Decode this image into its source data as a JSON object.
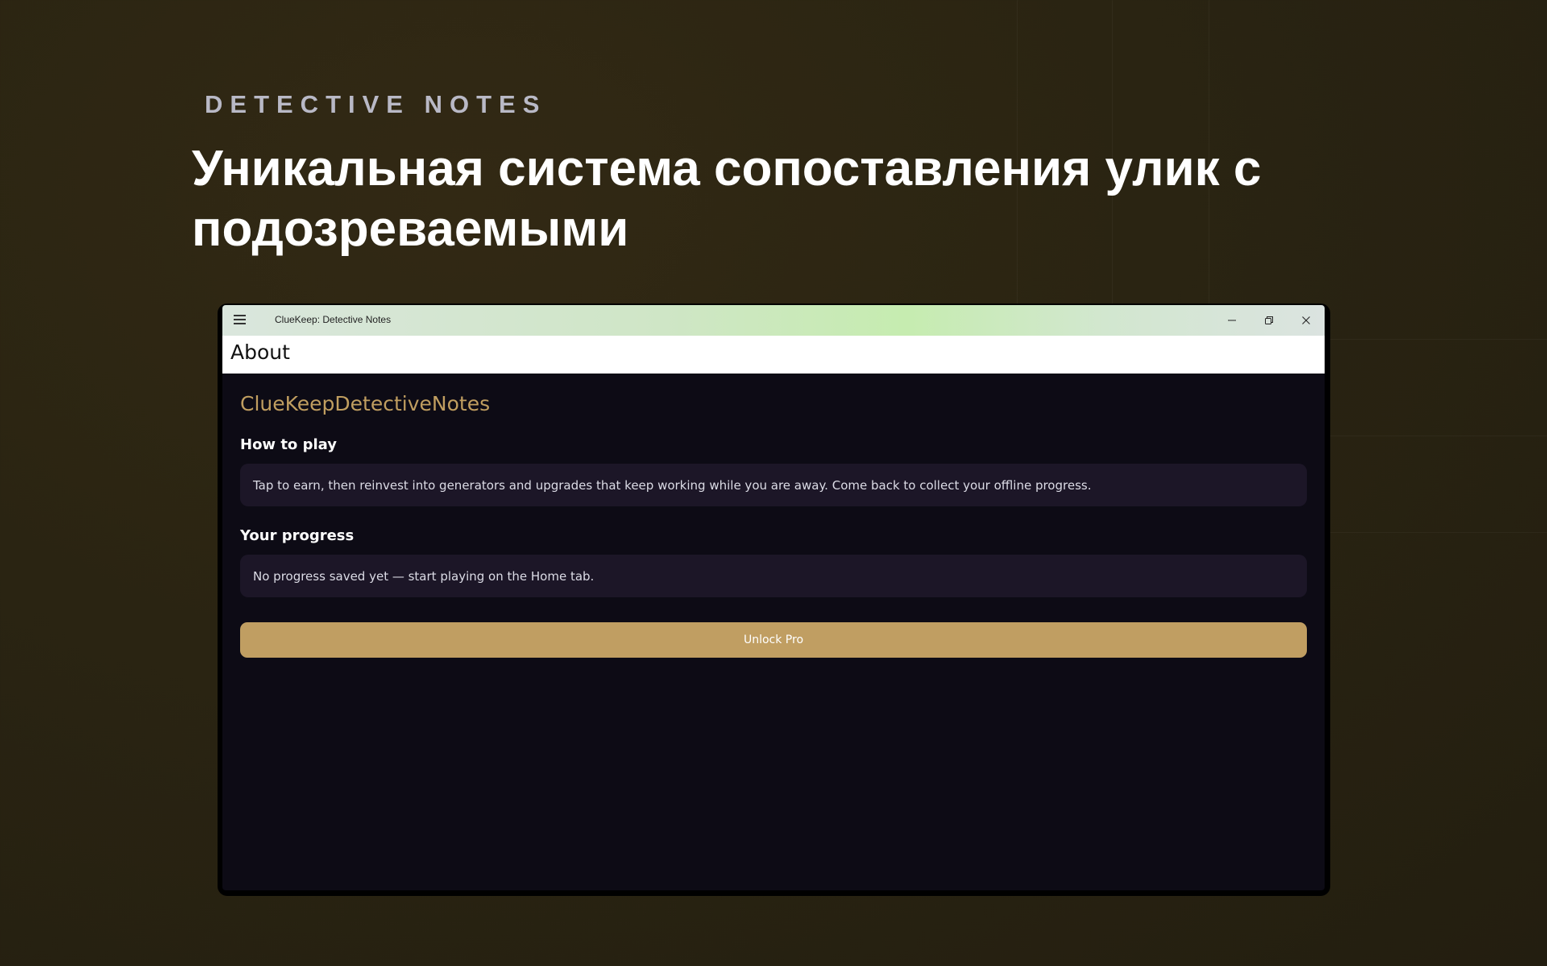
{
  "promo": {
    "eyebrow": "DETECTIVE NOTES",
    "headline": "Уникальная система сопоставления улик с подозреваемыми"
  },
  "window": {
    "title": "ClueKeep: Detective Notes",
    "controls": [
      "minimize-icon",
      "restore-icon",
      "close-icon"
    ]
  },
  "header": {
    "title": "About"
  },
  "content": {
    "app_name": "ClueKeepDetectiveNotes",
    "how_to_play": {
      "title": "How to play",
      "text": "Tap to earn, then reinvest into generators and upgrades that keep working while you are away. Come back to collect your offline progress."
    },
    "progress": {
      "title": "Your progress",
      "text": "No progress saved yet — start playing on the Home tab."
    },
    "unlock_label": "Unlock Pro"
  },
  "colors": {
    "background": "#2a2412",
    "accent_gold": "#c09e62",
    "card": "#1c1627",
    "window_bg": "#0d0b15"
  }
}
